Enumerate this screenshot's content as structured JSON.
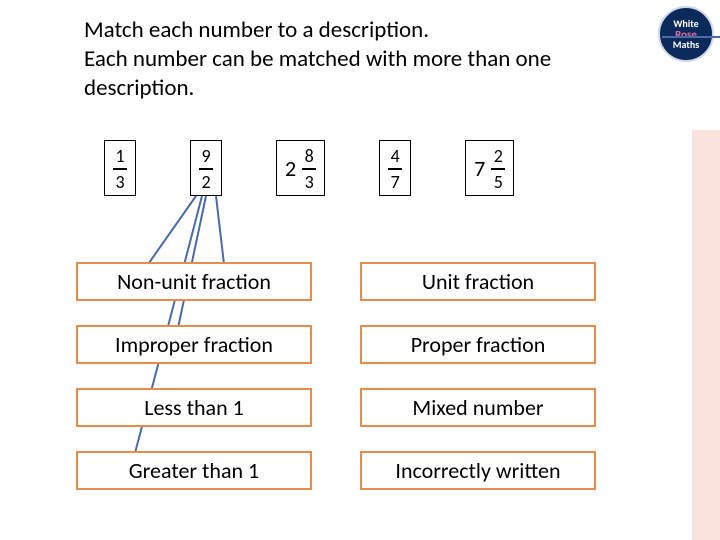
{
  "logo": {
    "line1": "White",
    "line2": "Rose",
    "line3": "Maths"
  },
  "instruction": {
    "line1": "Match each number to a description.",
    "line2": "Each number can be matched with more than one description."
  },
  "fractions": [
    {
      "whole": "",
      "num": "1",
      "den": "3"
    },
    {
      "whole": "",
      "num": "9",
      "den": "2"
    },
    {
      "whole": "2",
      "num": "8",
      "den": "3"
    },
    {
      "whole": "",
      "num": "4",
      "den": "7"
    },
    {
      "whole": "7",
      "num": "2",
      "den": "5"
    }
  ],
  "descriptions": {
    "r0c0": "Non-unit fraction",
    "r0c1": "Unit fraction",
    "r1c0": "Improper fraction",
    "r1c1": "Proper fraction",
    "r2c0": "Less than 1",
    "r2c1": "Mixed number",
    "r3c0": "Greater than 1",
    "r3c1": "Incorrectly written"
  },
  "colors": {
    "accent": "#e98c4b",
    "line": "#4a6aa8"
  }
}
